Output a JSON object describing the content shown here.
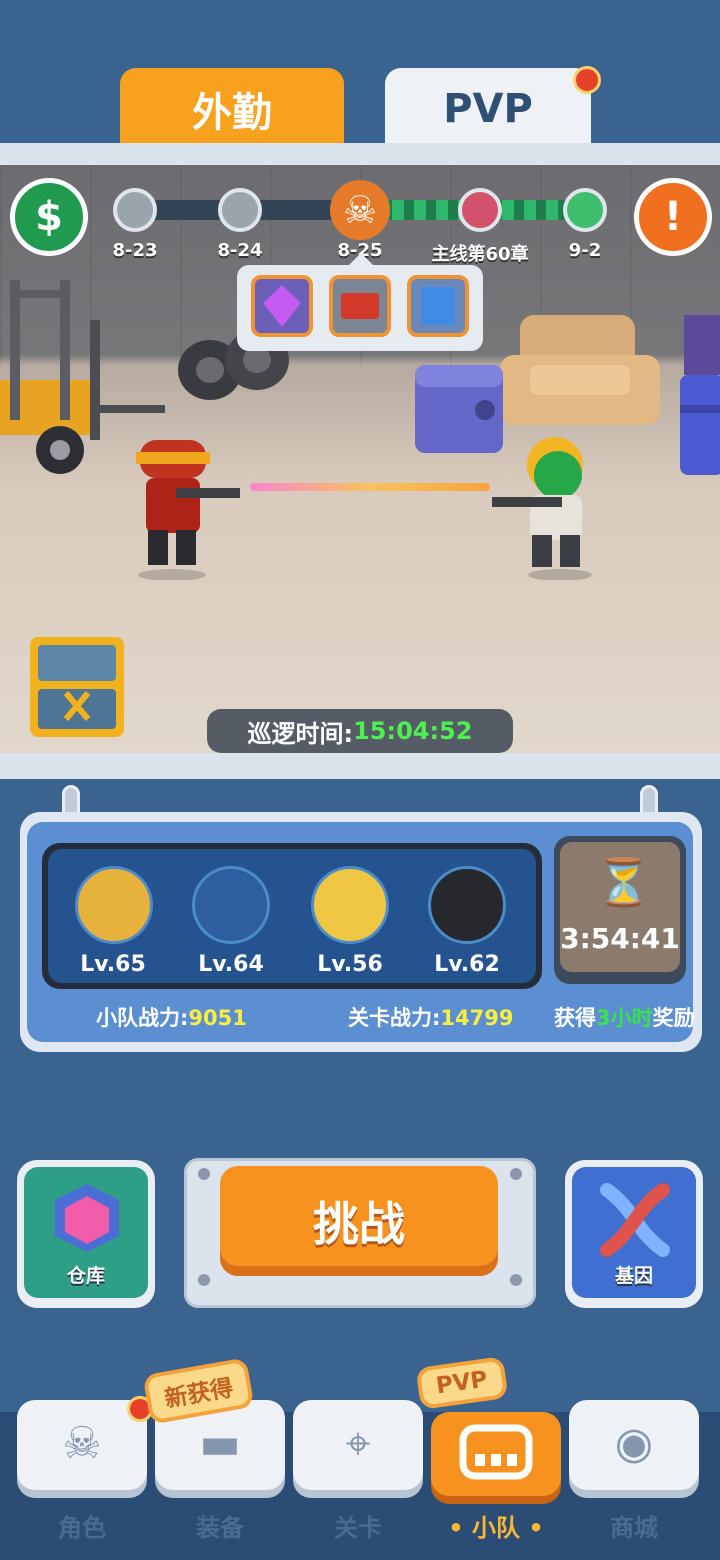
{
  "top_tabs": [
    {
      "label": "外勤",
      "active": true
    },
    {
      "label": "PVP",
      "active": false,
      "has_notification": true
    }
  ],
  "stage_track": {
    "nodes": [
      {
        "label": "8-23",
        "state": "cleared"
      },
      {
        "label": "8-24",
        "state": "cleared"
      },
      {
        "label": "8-25",
        "state": "current-boss"
      },
      {
        "label": "主线第60章",
        "state": "locked"
      },
      {
        "label": "9-2",
        "state": "next"
      }
    ],
    "left_button_icon": "cash-icon",
    "right_button_icon": "exclamation-icon"
  },
  "rewards": [
    {
      "icon": "purple-gem-icon"
    },
    {
      "icon": "red-ticket-icon"
    },
    {
      "icon": "blue-card-icon"
    }
  ],
  "patrol": {
    "label": "巡逻时间:",
    "time": "15:04:52"
  },
  "team": {
    "heroes": [
      {
        "level": "Lv.65"
      },
      {
        "level": "Lv.64"
      },
      {
        "level": "Lv.56"
      },
      {
        "level": "Lv.62"
      }
    ],
    "team_power_label": "小队战力:",
    "team_power_value": "9051",
    "stage_power_label": "关卡战力:",
    "stage_power_value": "14799",
    "reward_timer": "3:54:41",
    "reward_prefix": "获得",
    "reward_hours": "3小时",
    "reward_suffix": "奖励"
  },
  "actions": {
    "warehouse_label": "仓库",
    "challenge_label": "挑战",
    "gene_label": "基因"
  },
  "bottom_nav": {
    "items": [
      {
        "label": "角色",
        "icon": "skull-icon"
      },
      {
        "label": "装备",
        "icon": "gun-icon"
      },
      {
        "label": "关卡",
        "icon": "map-icon"
      },
      {
        "label": "小队",
        "icon": "squad-icon",
        "active": true
      },
      {
        "label": "商城",
        "icon": "shop-icon"
      }
    ],
    "equip_badge": "新获得",
    "squad_badge": "PVP"
  },
  "colors": {
    "orange": "#f7921f",
    "panel_blue": "#5b8fd1",
    "power_yellow": "#fbee42",
    "time_green": "#4ef04f"
  }
}
